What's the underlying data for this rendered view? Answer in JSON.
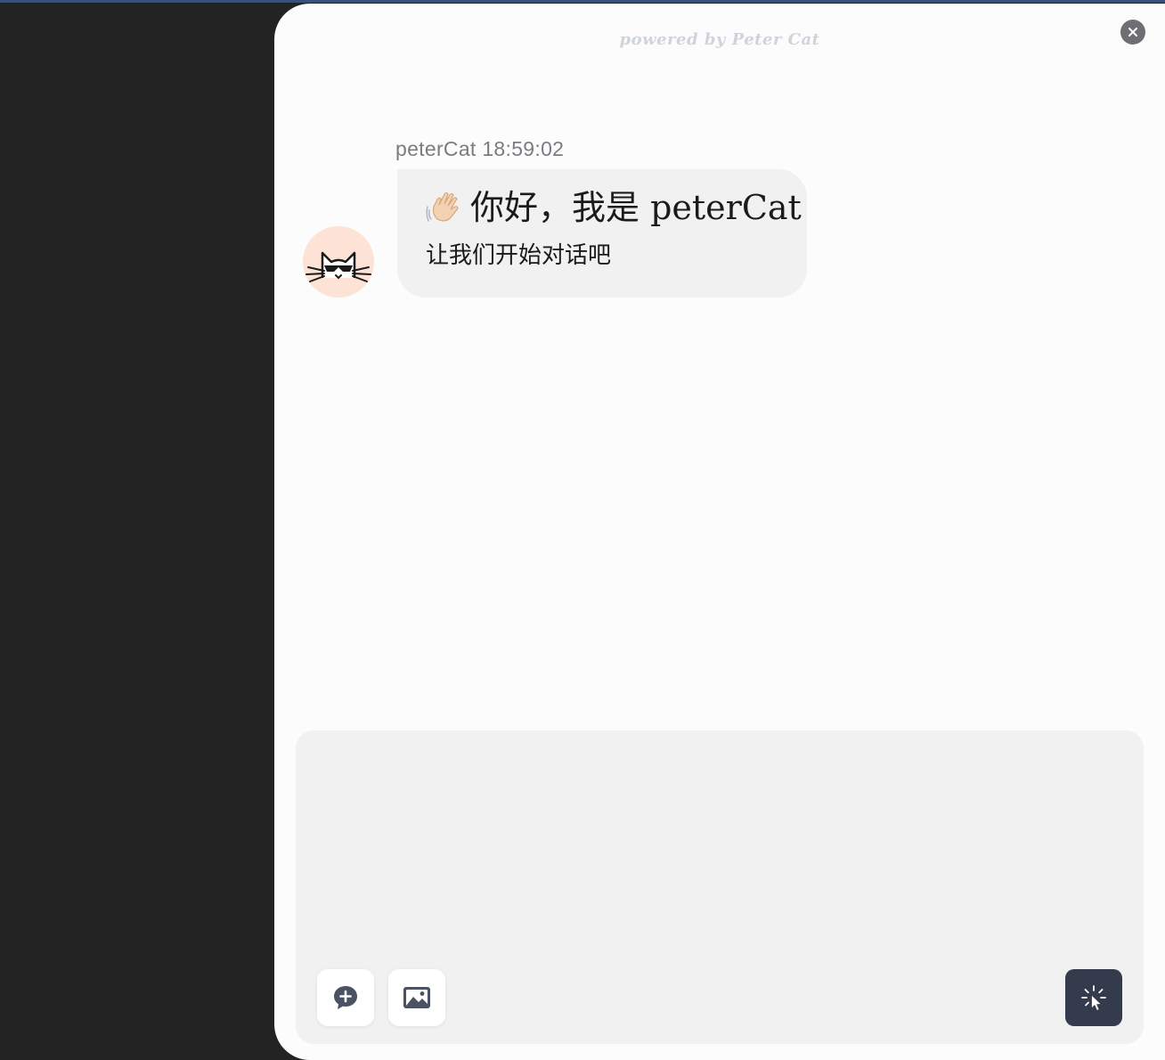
{
  "header": {
    "powered_by": "powered by Peter Cat",
    "close_icon": "close-icon"
  },
  "message": {
    "sender": "peterCat",
    "time": "18:59:02",
    "avatar_icon": "cat-avatar-icon",
    "greeting_emoji": "waving-hand-emoji",
    "greeting": "你好，我是 peterCat",
    "subtitle": "让我们开始对话吧"
  },
  "composer": {
    "input_value": "",
    "new_chat_icon": "chat-plus-icon",
    "image_icon": "image-icon",
    "send_icon": "pointer-click-icon"
  },
  "colors": {
    "backdrop": "#232323",
    "panel": "#fcfcfc",
    "bubble": "#f1f1f1",
    "send_button": "#343b4d",
    "close_button": "#6e6e73",
    "avatar_bg": "#fde3d5"
  }
}
